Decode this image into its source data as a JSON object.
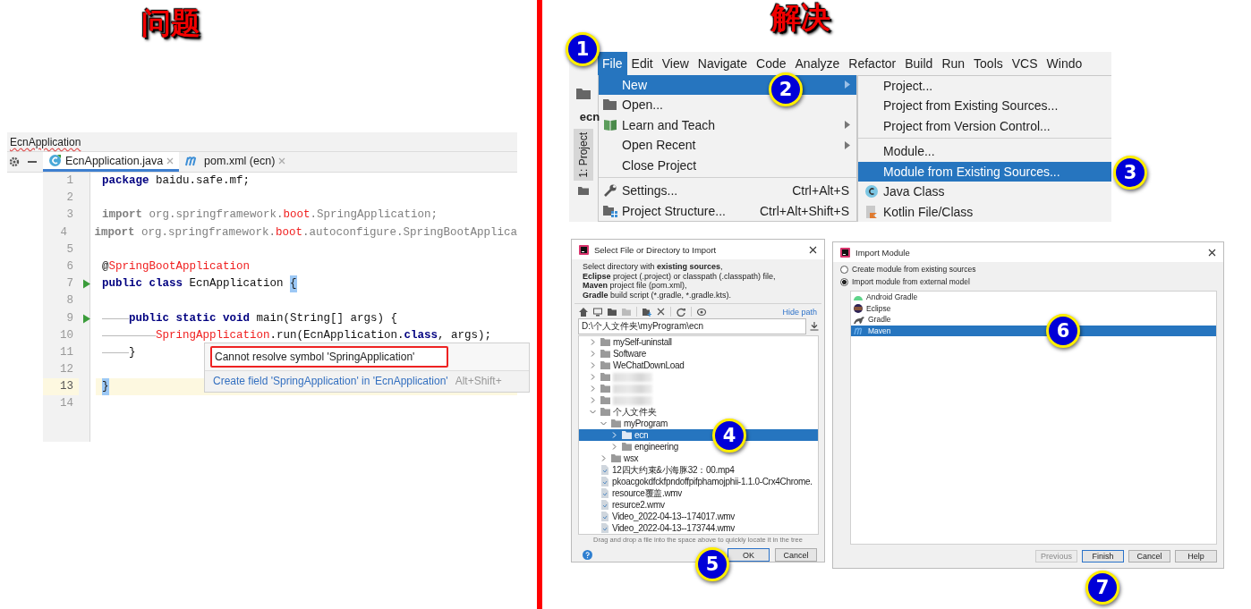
{
  "headings": [
    {
      "text": "问题"
    },
    {
      "text": "解决"
    }
  ],
  "editor": {
    "breadcrumb": "EcnApplication",
    "tabs": [
      {
        "label": "EcnApplication.java",
        "kind": "java",
        "selected": true
      },
      {
        "label": "pom.xml (ecn)",
        "kind": "maven",
        "selected": false
      }
    ],
    "lines": [
      {
        "number": "1",
        "current": false,
        "run": false,
        "tokens": [
          {
            "kind": "keyword",
            "text": "package"
          },
          {
            "kind": "plain",
            "text": " baidu.safe.mf;"
          }
        ]
      },
      {
        "number": "2",
        "current": false,
        "run": false
      },
      {
        "number": "3",
        "current": false,
        "run": false,
        "tokens": [
          {
            "kind": "muted-keyword",
            "text": "import"
          },
          {
            "kind": "muted",
            "text": " org.springframework."
          },
          {
            "kind": "error",
            "text": "boot"
          },
          {
            "kind": "muted",
            "text": ".SpringApplication;"
          }
        ]
      },
      {
        "number": "4",
        "current": false,
        "run": false,
        "tokens": [
          {
            "kind": "muted-keyword",
            "text": "import"
          },
          {
            "kind": "muted",
            "text": " org.springframework."
          },
          {
            "kind": "error",
            "text": "boot"
          },
          {
            "kind": "muted",
            "text": ".autoconfigure.SpringBootApplica"
          }
        ]
      },
      {
        "number": "5",
        "current": false,
        "run": false
      },
      {
        "number": "6",
        "current": false,
        "run": false,
        "tokens": [
          {
            "kind": "plain",
            "text": "@"
          },
          {
            "kind": "error",
            "text": "SpringBootApplication"
          }
        ]
      },
      {
        "number": "7",
        "current": false,
        "run": true,
        "tokens": [
          {
            "kind": "keyword",
            "text": "public class"
          },
          {
            "kind": "plain",
            "text": " EcnApplication "
          },
          {
            "kind": "brace",
            "text": "{"
          }
        ]
      },
      {
        "number": "8",
        "current": false,
        "run": false
      },
      {
        "number": "9",
        "current": false,
        "run": true,
        "tokens": [
          {
            "kind": "guide"
          },
          {
            "kind": "keyword",
            "text": "public static void"
          },
          {
            "kind": "plain",
            "text": " main(String[] args) {"
          }
        ]
      },
      {
        "number": "10",
        "current": false,
        "run": false,
        "tokens": [
          {
            "kind": "guide"
          },
          {
            "kind": "guide"
          },
          {
            "kind": "error",
            "text": "SpringApplication"
          },
          {
            "kind": "plain",
            "text": ".run(EcnApplication."
          },
          {
            "kind": "keyword",
            "text": "class"
          },
          {
            "kind": "plain",
            "text": ", args);"
          }
        ]
      },
      {
        "number": "11",
        "current": false,
        "run": false,
        "tokens": [
          {
            "kind": "guide"
          },
          {
            "kind": "plain",
            "text": "}"
          }
        ]
      },
      {
        "number": "12",
        "current": false,
        "run": false
      },
      {
        "number": "13",
        "current": true,
        "run": false,
        "tokens": [
          {
            "kind": "brace",
            "text": "}"
          }
        ]
      },
      {
        "number": "14",
        "current": false,
        "run": false
      }
    ],
    "popup": {
      "error": "Cannot resolve symbol 'SpringApplication'",
      "fix": "Create field 'SpringApplication' in 'EcnApplication'",
      "shortcut": "Alt+Shift+"
    }
  },
  "ide_menu": {
    "project_tab": "ecn",
    "tool_window": "1: Project",
    "menubar": [
      {
        "label": "File",
        "selected": true
      },
      {
        "label": "Edit",
        "selected": false
      },
      {
        "label": "View",
        "selected": false
      },
      {
        "label": "Navigate",
        "selected": false
      },
      {
        "label": "Code",
        "selected": false
      },
      {
        "label": "Analyze",
        "selected": false
      },
      {
        "label": "Refactor",
        "selected": false
      },
      {
        "label": "Build",
        "selected": false
      },
      {
        "label": "Run",
        "selected": false
      },
      {
        "label": "Tools",
        "selected": false
      },
      {
        "label": "VCS",
        "selected": false
      },
      {
        "label": "Windo",
        "selected": false
      }
    ],
    "file_menu": [
      {
        "items": [
          {
            "label": "New",
            "kind": "plain",
            "submenu": true,
            "selected": true
          },
          {
            "label": "Open...",
            "kind": "folder",
            "submenu": false,
            "selected": false
          },
          {
            "label": "Learn and Teach",
            "kind": "book",
            "submenu": true,
            "selected": false
          },
          {
            "label": "Open Recent",
            "kind": "plain",
            "submenu": true,
            "selected": false
          },
          {
            "label": "Close Project",
            "kind": "plain",
            "submenu": false,
            "selected": false
          }
        ]
      },
      {
        "items": [
          {
            "label": "Settings...",
            "kind": "wrench",
            "submenu": false,
            "selected": false,
            "shortcut": "Ctrl+Alt+S"
          },
          {
            "label": "Project Structure...",
            "kind": "structure",
            "submenu": false,
            "selected": false,
            "shortcut": "Ctrl+Alt+Shift+S"
          }
        ]
      }
    ],
    "new_submenu": [
      {
        "items": [
          {
            "label": "Project...",
            "kind": "plain",
            "selected": false
          },
          {
            "label": "Project from Existing Sources...",
            "kind": "plain",
            "selected": false
          },
          {
            "label": "Project from Version Control...",
            "kind": "plain",
            "selected": false
          }
        ]
      },
      {
        "items": [
          {
            "label": "Module...",
            "kind": "plain",
            "selected": false
          },
          {
            "label": "Module from Existing Sources...",
            "kind": "plain",
            "selected": true
          },
          {
            "label": "Java Class",
            "kind": "java",
            "selected": false
          },
          {
            "label": "Kotlin File/Class",
            "kind": "kotlin",
            "selected": false
          }
        ]
      }
    ]
  },
  "import_dialog": {
    "title": "Select File or Directory to Import",
    "description": [
      "Select directory with **existing sources**,",
      "**Eclipse** project (.project) or classpath (.classpath) file,",
      "**Maven** project file (pom.xml),",
      "**Gradle** build script (*.gradle, *.gradle.kts)."
    ],
    "hide_path": "Hide path",
    "path": "D:\\个人文件夹\\myProgram\\ecn",
    "tree": [
      {
        "kind": "folder",
        "label": "mySelf-uninstall",
        "expanded": false,
        "selected": false
      },
      {
        "kind": "folder",
        "label": "Software",
        "expanded": false,
        "selected": false
      },
      {
        "kind": "folder",
        "label": "WeChatDownLoad",
        "expanded": false,
        "selected": false
      },
      {
        "kind": "blurred",
        "expanded": false,
        "selected": false
      },
      {
        "kind": "blurred",
        "expanded": false,
        "selected": false
      },
      {
        "kind": "blurred",
        "expanded": false,
        "selected": false
      },
      {
        "kind": "folder",
        "label": "个人文件夹",
        "expanded": true,
        "selected": false,
        "children": [
          {
            "kind": "folder",
            "label": "myProgram",
            "expanded": true,
            "selected": false,
            "children": [
              {
                "kind": "folder",
                "label": "ecn",
                "expanded": false,
                "selected": true
              },
              {
                "kind": "folder",
                "label": "engineering",
                "expanded": false,
                "selected": false
              }
            ]
          },
          {
            "kind": "folder",
            "label": "wsx",
            "expanded": false,
            "selected": false
          },
          {
            "kind": "file",
            "label": "12四大约束&小海豚32：00.mp4",
            "selected": false
          },
          {
            "kind": "file",
            "label": "pkoacgokdfckfpndoffpifphamojphii-1.1.0-Crx4Chrome.",
            "selected": false
          },
          {
            "kind": "file",
            "label": "resource覆盖.wmv",
            "selected": false
          },
          {
            "kind": "file",
            "label": "resurce2.wmv",
            "selected": false
          },
          {
            "kind": "file",
            "label": "Video_2022-04-13--174017.wmv",
            "selected": false
          },
          {
            "kind": "file",
            "label": "Video_2022-04-13--173744.wmv",
            "selected": false
          }
        ]
      }
    ],
    "hint": "Drag and drop a file into the space above to quickly locate it in the tree",
    "buttons": [
      {
        "label": "OK",
        "default": true
      },
      {
        "label": "Cancel",
        "default": false
      }
    ]
  },
  "module_dialog": {
    "title": "Import Module",
    "options": [
      {
        "label": "Create module from existing sources",
        "selected": false
      },
      {
        "label": "Import module from external model",
        "selected": true
      }
    ],
    "models": [
      {
        "label": "Android Gradle",
        "kind": "android",
        "selected": false
      },
      {
        "label": "Eclipse",
        "kind": "eclipse",
        "selected": false
      },
      {
        "label": "Gradle",
        "kind": "gradle",
        "selected": false
      },
      {
        "label": "Maven",
        "kind": "maven",
        "selected": true
      }
    ],
    "buttons": [
      {
        "label": "Previous",
        "disabled": true,
        "default": false
      },
      {
        "label": "Finish",
        "disabled": false,
        "default": true
      },
      {
        "label": "Cancel",
        "disabled": false,
        "default": false
      },
      {
        "label": "Help",
        "disabled": false,
        "default": false
      }
    ]
  },
  "steps": [
    {
      "label": "1"
    },
    {
      "label": "2"
    },
    {
      "label": "3"
    },
    {
      "label": "4"
    },
    {
      "label": "5"
    },
    {
      "label": "6"
    },
    {
      "label": "7"
    }
  ]
}
